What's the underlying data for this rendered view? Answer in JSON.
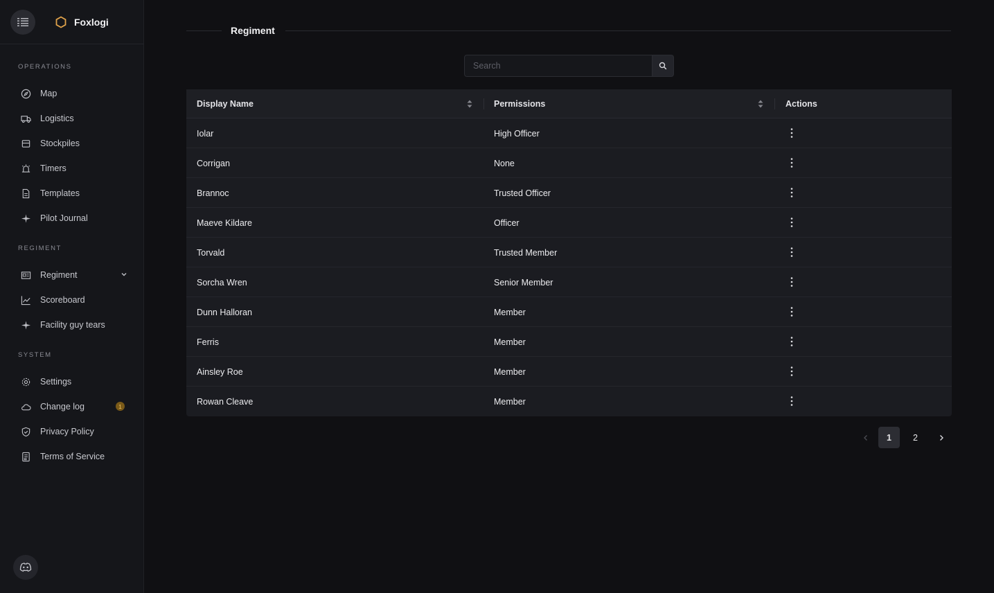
{
  "brand": {
    "name": "Foxlogi"
  },
  "sidebar": {
    "sections": [
      {
        "label": "OPERATIONS",
        "items": [
          {
            "label": "Map",
            "icon": "compass-icon"
          },
          {
            "label": "Logistics",
            "icon": "truck-icon"
          },
          {
            "label": "Stockpiles",
            "icon": "box-icon"
          },
          {
            "label": "Timers",
            "icon": "alarm-icon"
          },
          {
            "label": "Templates",
            "icon": "file-icon"
          },
          {
            "label": "Pilot Journal",
            "icon": "plane-icon"
          }
        ]
      },
      {
        "label": "REGIMENT",
        "items": [
          {
            "label": "Regiment",
            "icon": "id-card-icon"
          },
          {
            "label": "Scoreboard",
            "icon": "chart-line-icon"
          },
          {
            "label": "Facility guy tears",
            "icon": "plane-icon"
          }
        ]
      },
      {
        "label": "SYSTEM",
        "items": [
          {
            "label": "Settings",
            "icon": "gear-icon"
          },
          {
            "label": "Change log",
            "icon": "cloud-icon",
            "badge": "1"
          },
          {
            "label": "Privacy Policy",
            "icon": "shield-icon"
          },
          {
            "label": "Terms of Service",
            "icon": "document-icon"
          }
        ]
      }
    ]
  },
  "main": {
    "title": "Regiment",
    "search": {
      "placeholder": "Search",
      "value": ""
    },
    "table": {
      "columns": [
        "Display Name",
        "Permissions",
        "Actions"
      ],
      "rows": [
        {
          "name": "Iolar",
          "permission": "High Officer"
        },
        {
          "name": "Corrigan",
          "permission": "None"
        },
        {
          "name": "Brannoc",
          "permission": "Trusted Officer"
        },
        {
          "name": "Maeve Kildare",
          "permission": "Officer"
        },
        {
          "name": "Torvald",
          "permission": "Trusted Member"
        },
        {
          "name": "Sorcha Wren",
          "permission": "Senior Member"
        },
        {
          "name": "Dunn Halloran",
          "permission": "Member"
        },
        {
          "name": "Ferris",
          "permission": "Member"
        },
        {
          "name": "Ainsley Roe",
          "permission": "Member"
        },
        {
          "name": "Rowan Cleave",
          "permission": "Member"
        }
      ]
    },
    "pagination": {
      "pages": [
        "1",
        "2"
      ],
      "current": "1"
    }
  },
  "colors": {
    "accent": "#e0a24a",
    "background": "#101013",
    "sidebar": "#15161a"
  }
}
